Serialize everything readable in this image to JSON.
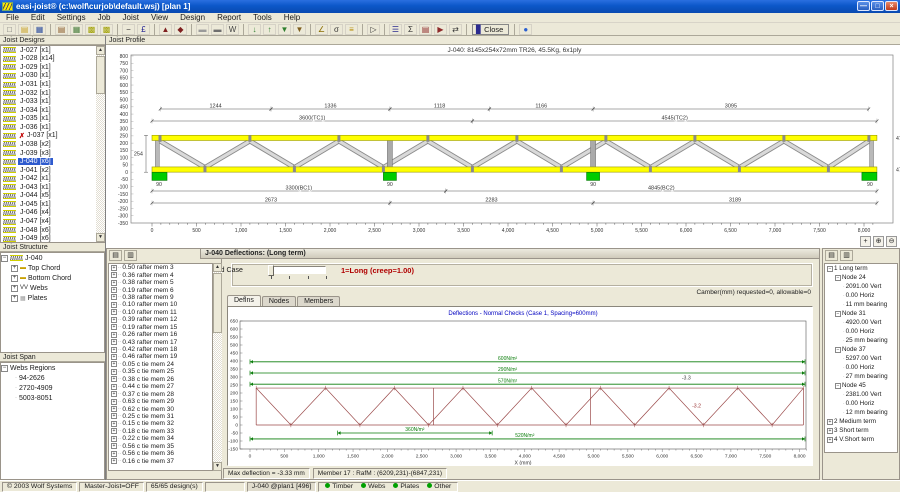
{
  "window": {
    "title": "easi-joist®  (c:\\wolf\\curjob\\default.wsj)  [plan 1]"
  },
  "menu": {
    "items": [
      "File",
      "Edit",
      "Settings",
      "Job",
      "Joist",
      "View",
      "Design",
      "Report",
      "Tools",
      "Help"
    ]
  },
  "toolbar": {
    "close_label": "Close",
    "icons": [
      {
        "name": "new-file-icon",
        "glyph": "□",
        "color": "#666"
      },
      {
        "name": "open-folder-icon",
        "glyph": "▤",
        "color": "#c9a227"
      },
      {
        "name": "save-icon",
        "glyph": "▦",
        "color": "#2f4f9f"
      },
      {
        "sep": true
      },
      {
        "name": "job-properties-icon",
        "glyph": "▤",
        "color": "#8a5a2a"
      },
      {
        "name": "joist-grid-icon",
        "glyph": "▦",
        "color": "#4a7f3f"
      },
      {
        "name": "plan-view-icon",
        "glyph": "▩",
        "color": "#a0a000"
      },
      {
        "name": "plan-edit-icon",
        "glyph": "▩",
        "color": "#a0a000"
      },
      {
        "sep": true
      },
      {
        "name": "minus-icon",
        "glyph": "−",
        "color": "#333333"
      },
      {
        "name": "price-icon",
        "glyph": "£",
        "color": "#1a1a8f"
      },
      {
        "sep": true
      },
      {
        "name": "truss-icon",
        "glyph": "▲",
        "color": "#7f1f1f"
      },
      {
        "name": "loads-icon",
        "glyph": "◆",
        "color": "#7f1f1f"
      },
      {
        "sep": true
      },
      {
        "name": "dimension-icon",
        "glyph": "▬",
        "color": "#9a9a9a"
      },
      {
        "name": "bearing-icon",
        "glyph": "▬",
        "color": "#6f6f6f"
      },
      {
        "name": "web-design-icon",
        "glyph": "W",
        "color": "#444444"
      },
      {
        "sep": true
      },
      {
        "name": "wind-load-icon",
        "glyph": "↓",
        "color": "#2f7f2f"
      },
      {
        "name": "uplift-load-icon",
        "glyph": "↑",
        "color": "#2f7f2f"
      },
      {
        "name": "point-load-icon",
        "glyph": "▼",
        "color": "#2f7f2f"
      },
      {
        "name": "area-load-icon",
        "glyph": "▼",
        "color": "#7f5f1f"
      },
      {
        "sep": true
      },
      {
        "name": "angle-icon",
        "glyph": "∠",
        "color": "#8a6d00"
      },
      {
        "name": "stress-icon",
        "glyph": "σ",
        "color": "#333333"
      },
      {
        "name": "deflection-icon",
        "glyph": "≡",
        "color": "#b58900"
      },
      {
        "sep": true
      },
      {
        "name": "pointer-icon",
        "glyph": "▷",
        "color": "#333333"
      },
      {
        "sep": true
      },
      {
        "name": "report-summary-icon",
        "glyph": "☰",
        "color": "#2a2a8f"
      },
      {
        "name": "report-sum-icon",
        "glyph": "Σ",
        "color": "#333333"
      },
      {
        "name": "report-sheet-icon",
        "glyph": "▤",
        "color": "#8f2a2a"
      },
      {
        "name": "report-run-icon",
        "glyph": "▶",
        "color": "#8f2a2a"
      },
      {
        "name": "transfer-icon",
        "glyph": "⇄",
        "color": "#333333"
      },
      {
        "sep": true
      }
    ],
    "after_close_icons": [
      {
        "name": "help-icon",
        "glyph": "●",
        "color": "#2a5fd0"
      }
    ]
  },
  "left": {
    "designs": {
      "title": "Joist Designs",
      "items": [
        {
          "label": "J-027 [x1]"
        },
        {
          "label": "J-028 [x14]"
        },
        {
          "label": "J-029 [x1]"
        },
        {
          "label": "J-030 [x1]"
        },
        {
          "label": "J-031 [x1]"
        },
        {
          "label": "J-032 [x1]"
        },
        {
          "label": "J-033 [x1]"
        },
        {
          "label": "J-034 [x1]"
        },
        {
          "label": "J-035 [x1]"
        },
        {
          "label": "J-036 [x1]"
        },
        {
          "label": "J-037 [x1]",
          "error": true
        },
        {
          "label": "J-038 [x2]"
        },
        {
          "label": "J-039 [x3]"
        },
        {
          "label": "J-040 [x6]",
          "selected": true
        },
        {
          "label": "J-041 [x2]"
        },
        {
          "label": "J-042 [x1]"
        },
        {
          "label": "J-043 [x1]"
        },
        {
          "label": "J-044 [x5]"
        },
        {
          "label": "J-045 [x1]"
        },
        {
          "label": "J-046 [x4]"
        },
        {
          "label": "J-047 [x4]"
        },
        {
          "label": "J-048 [x6]"
        },
        {
          "label": "J-049 [x6]"
        }
      ]
    },
    "structure": {
      "title": "Joist Structure",
      "root": "J-040",
      "children": [
        {
          "label": "Top Chord",
          "icon": "chord-icon",
          "glyph": "▬",
          "color": "#c8a000"
        },
        {
          "label": "Bottom Chord",
          "icon": "chord-icon",
          "glyph": "▬",
          "color": "#c8a000"
        },
        {
          "label": "Webs",
          "icon": "webs-icon",
          "glyph": "VV",
          "color": "#333333"
        },
        {
          "label": "Plates",
          "icon": "plate-icon",
          "glyph": "▦",
          "color": "#999999"
        }
      ]
    },
    "span": {
      "title": "Joist Span",
      "root": "Webs Regions",
      "children": [
        {
          "label": "94-2626"
        },
        {
          "label": "2720-4909"
        },
        {
          "label": "5003-8051"
        }
      ]
    }
  },
  "profile": {
    "panel_title": "Joist Profile",
    "drawing_title": "J-040: 8145x254x72mm TR26, 45.5Kg, 6x1ply",
    "length_mm": 8145,
    "height_mm": 254,
    "supports_mm": [
      0,
      2673,
      4956,
      8145
    ],
    "bearing_label": "90",
    "top_dims": [
      {
        "label": "1244",
        "from": 93,
        "to": 1337
      },
      {
        "label": "1336",
        "from": 1337,
        "to": 2673
      },
      {
        "label": "1118",
        "from": 2673,
        "to": 3791
      },
      {
        "label": "1166",
        "from": 3791,
        "to": 4957
      },
      {
        "label": "3095",
        "from": 4957,
        "to": 8052
      }
    ],
    "tc_dims": [
      {
        "label": "3600(TC1)",
        "from": 0,
        "to": 3600
      },
      {
        "label": "4545(TC2)",
        "from": 3600,
        "to": 8145
      }
    ],
    "bc_dims": [
      {
        "label": "3300(BC1)",
        "from": 0,
        "to": 3300
      },
      {
        "label": "4845(BC2)",
        "from": 3300,
        "to": 8145
      }
    ],
    "span_dims": [
      {
        "label": "2673",
        "from": 0,
        "to": 2673
      },
      {
        "label": "2283",
        "from": 2673,
        "to": 4956
      },
      {
        "label": "3189",
        "from": 4956,
        "to": 8145
      }
    ],
    "height_dim_label": "254",
    "edge_labels": [
      "47",
      "47"
    ],
    "web_top_nodes": [
      90,
      1100,
      2100,
      3100,
      4100,
      5100,
      6100,
      7100,
      8055
    ],
    "web_bottom_nodes": [
      595,
      1600,
      2600,
      3600,
      4600,
      5600,
      6600,
      7600
    ],
    "y_axis": {
      "max": 800,
      "min": -350,
      "step": 50
    }
  },
  "axis": {
    "x_ticks": [
      {
        "mm": 0,
        "label": "0"
      },
      {
        "mm": 500,
        "label": "500"
      },
      {
        "mm": 1000,
        "label": "1,000"
      },
      {
        "mm": 1500,
        "label": "1,500"
      },
      {
        "mm": 2000,
        "label": "2,000"
      },
      {
        "mm": 2500,
        "label": "2,500"
      },
      {
        "mm": 3000,
        "label": "3,000"
      },
      {
        "mm": 3500,
        "label": "3,500"
      },
      {
        "mm": 4000,
        "label": "4,000"
      },
      {
        "mm": 4500,
        "label": "4,500"
      },
      {
        "mm": 5000,
        "label": "5,000"
      },
      {
        "mm": 5500,
        "label": "5,500"
      },
      {
        "mm": 6000,
        "label": "6,000"
      },
      {
        "mm": 6500,
        "label": "6,500"
      },
      {
        "mm": 7000,
        "label": "7,000"
      },
      {
        "mm": 7500,
        "label": "7,500"
      },
      {
        "mm": 8000,
        "label": "8,000"
      }
    ]
  },
  "members": {
    "items": [
      "0.50 rafter mem 3",
      "0.36 rafter mem 4",
      "0.38 rafter mem 5",
      "0.19 rafter mem 6",
      "0.38 rafter mem 9",
      "0.10 rafter mem 10",
      "0.10 rafter mem 11",
      "0.39 rafter mem 12",
      "0.19 rafter mem 15",
      "0.26 rafter mem 16",
      "0.43 rafter mem 17",
      "0.42 rafter mem 18",
      "0.46 rafter mem 19",
      "0.05 c tie mem 24",
      "0.35 c tie mem 25",
      "0.38 c tie mem 26",
      "0.44 c tie mem 27",
      "0.37 c tie mem 28",
      "0.63 c tie mem 29",
      "0.62 c tie mem 30",
      "0.25 c tie mem 31",
      "0.15 c tie mem 32",
      "0.18 c tie mem 33",
      "0.22 c tie mem 34",
      "0.56 c tie mem 35",
      "0.56 c tie mem 36",
      "0.16 c tie mem 37"
    ]
  },
  "dialog": {
    "title": "J-040 Deflections: (Long term)",
    "load_case_label": "Load Case",
    "load_case_value": "1=Long (creep=1.00)",
    "camber_note": "Camber(mm) requested=0, allowable=0",
    "tabs": [
      {
        "label": "Deflns",
        "selected": true
      },
      {
        "label": "Nodes"
      },
      {
        "label": "Members"
      }
    ],
    "status": {
      "left": "Max deflection =  -3.33 mm",
      "right": "Member 17 : RafM : (6209,231)-(6847,231)"
    }
  },
  "chart_data": {
    "type": "line",
    "title": "Deflections - Normal Checks (Case 1, Spacing=600mm)",
    "xlabel": "X (mm)",
    "x_range": [
      0,
      8200
    ],
    "y_range": [
      -150,
      650
    ],
    "y_tick_step": 50,
    "x_tick_step": 500,
    "grid": false,
    "load_lines": [
      {
        "label": "600N/m²",
        "y": 395,
        "from": 0,
        "to": 8145,
        "label_x": 3750
      },
      {
        "label": "290N/m²",
        "y": 325,
        "from": 0,
        "to": 8145,
        "label_x": 3750
      },
      {
        "label": "570N/m²",
        "y": 255,
        "from": 0,
        "to": 8145,
        "label_x": 3750
      },
      {
        "label": "360N/m²",
        "y": -50,
        "from": 1275,
        "to": 3525,
        "label_x": 2400
      },
      {
        "label": "520N/m²",
        "y": -87,
        "from": 0,
        "to": 8145,
        "label_x": 4000
      }
    ],
    "truss": {
      "from": 90,
      "to": 8055,
      "bottom": 0,
      "top": 231,
      "support_x": [
        2673,
        4956
      ],
      "web_top_nodes": [
        90,
        1100,
        2100,
        3100,
        4100,
        5100,
        6100,
        7100,
        8055
      ],
      "web_bottom_nodes": [
        595,
        1600,
        2600,
        3600,
        4600,
        5600,
        6600,
        7600
      ]
    },
    "annotations": [
      {
        "label": "-3.3",
        "x": 6350,
        "y": 285
      },
      {
        "label": "-3.2",
        "x": 6500,
        "y": 110
      }
    ],
    "max_deflection_mm": -3.33
  },
  "right_panel": {
    "load_terms": [
      {
        "label": "1 Long term",
        "expanded": true,
        "nodes": [
          {
            "label": "Node 24",
            "values": [
              "2091.00 Vert",
              "0.00 Horiz",
              "11 mm bearing"
            ]
          },
          {
            "label": "Node 31",
            "values": [
              "4920.00 Vert",
              "0.00 Horiz",
              "25 mm bearing"
            ]
          },
          {
            "label": "Node 37",
            "values": [
              "5297.00 Vert",
              "0.00 Horiz",
              "27 mm bearing"
            ]
          },
          {
            "label": "Node 45",
            "values": [
              "2381.00 Vert",
              "0.00 Horiz",
              "12 mm bearing"
            ]
          }
        ]
      },
      {
        "label": "2 Medium term"
      },
      {
        "label": "3 Short term"
      },
      {
        "label": "4 V.Short term"
      }
    ]
  },
  "statusbar": {
    "cells": [
      "© 2003 Wolf Systems",
      "Master-Joist=OFF",
      "65/65 design(s)"
    ],
    "active_cell": "J-040 @plan1 [496]",
    "legend": [
      {
        "label": "Timber",
        "color": "#00a000"
      },
      {
        "label": "Webs",
        "color": "#00a000"
      },
      {
        "label": "Plates",
        "color": "#00a000"
      },
      {
        "label": "Other",
        "color": "#00a000"
      }
    ]
  },
  "colors": {
    "selection": "#2f5bce",
    "chord_yellow": "#ffff00",
    "chord_border": "#999900",
    "support_green": "#00cc00",
    "support_border": "#007700",
    "truss_outline": "#9b4a4a",
    "load_green": "#0a7d0a",
    "chart_title_blue": "#0000c0",
    "loadcase_red": "#b00000",
    "web_gray": "#d9d9d9",
    "web_edge": "#8a8a8a"
  }
}
